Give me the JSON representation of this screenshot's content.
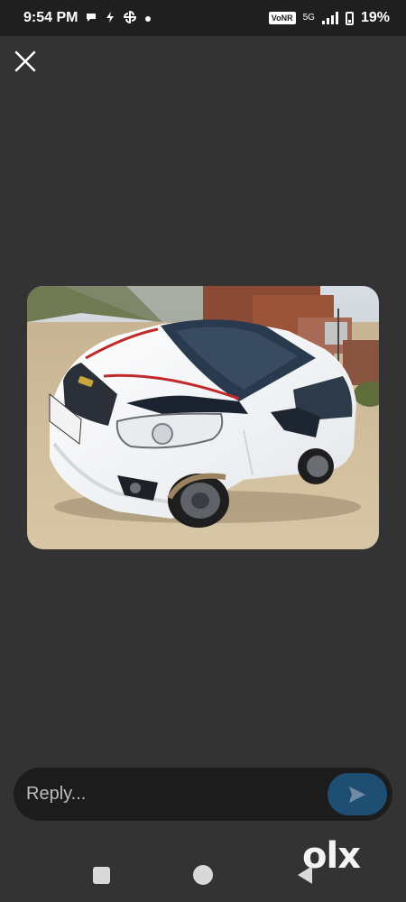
{
  "status_bar": {
    "time": "9:54 PM",
    "network_badge": "VoNR",
    "network_type": "5G",
    "battery_percent": "19%"
  },
  "viewer": {
    "close_icon": "close-icon",
    "image_description_icon": "car-photo"
  },
  "reply": {
    "placeholder": "Reply...",
    "send_icon": "send-icon"
  },
  "nav": {
    "recents_icon": "square-icon",
    "home_icon": "circle-icon",
    "back_icon": "triangle-back-icon"
  },
  "watermark": {
    "text": "olx"
  },
  "colors": {
    "background": "#333333",
    "status_bar": "#1f1f1f",
    "reply_bar": "#1c1c1c",
    "send_button": "#1f4e73"
  }
}
